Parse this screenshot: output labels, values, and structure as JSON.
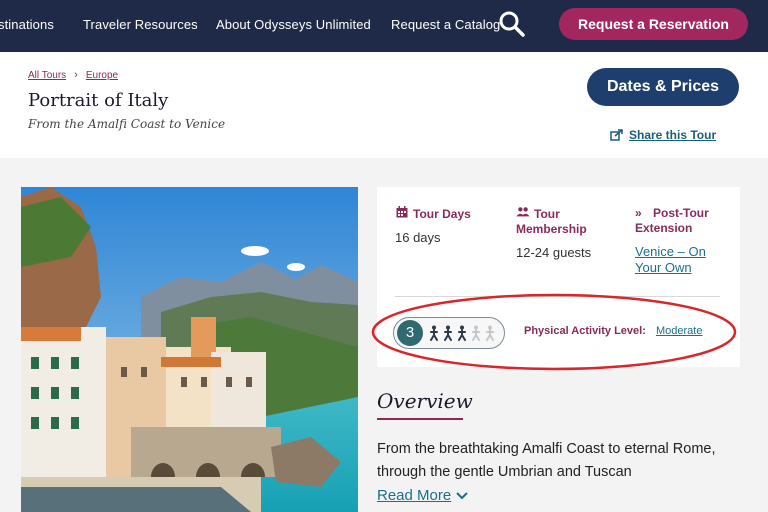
{
  "nav": {
    "links": [
      "stinations",
      "Traveler Resources",
      "About Odysseys Unlimited",
      "Request a Catalog"
    ],
    "reserve_label": "Request a Reservation",
    "colors": {
      "background": "#1e2a47",
      "accent": "#a3275f"
    }
  },
  "breadcrumb": {
    "items": [
      "All Tours",
      "Europe"
    ]
  },
  "tour": {
    "title": "Portrait of Italy",
    "subtitle": "From the Amalfi Coast to Venice"
  },
  "actions": {
    "dates_label": "Dates & Prices",
    "share_label": "Share this Tour"
  },
  "info": {
    "days": {
      "heading": "Tour Days",
      "icon": "calendar-icon",
      "value": "16 days"
    },
    "membership": {
      "heading_line1": "Tour",
      "heading_line2": "Membership",
      "icon": "users-icon",
      "value": "12-24 guests"
    },
    "extension": {
      "heading_line1": "Post-Tour",
      "heading_line2": "Extension",
      "icon": "double-chevron-right-icon",
      "value_line1": "Venice – On",
      "value_line2": "Your Own"
    },
    "activity": {
      "level": "3",
      "max_level": 5,
      "label": "Physical Activity Level:",
      "value": "Moderate"
    }
  },
  "overview": {
    "title": "Overview",
    "text": "From the breathtaking Amalfi Coast to eternal Rome, through the gentle Umbrian and Tuscan",
    "read_more": "Read More"
  }
}
